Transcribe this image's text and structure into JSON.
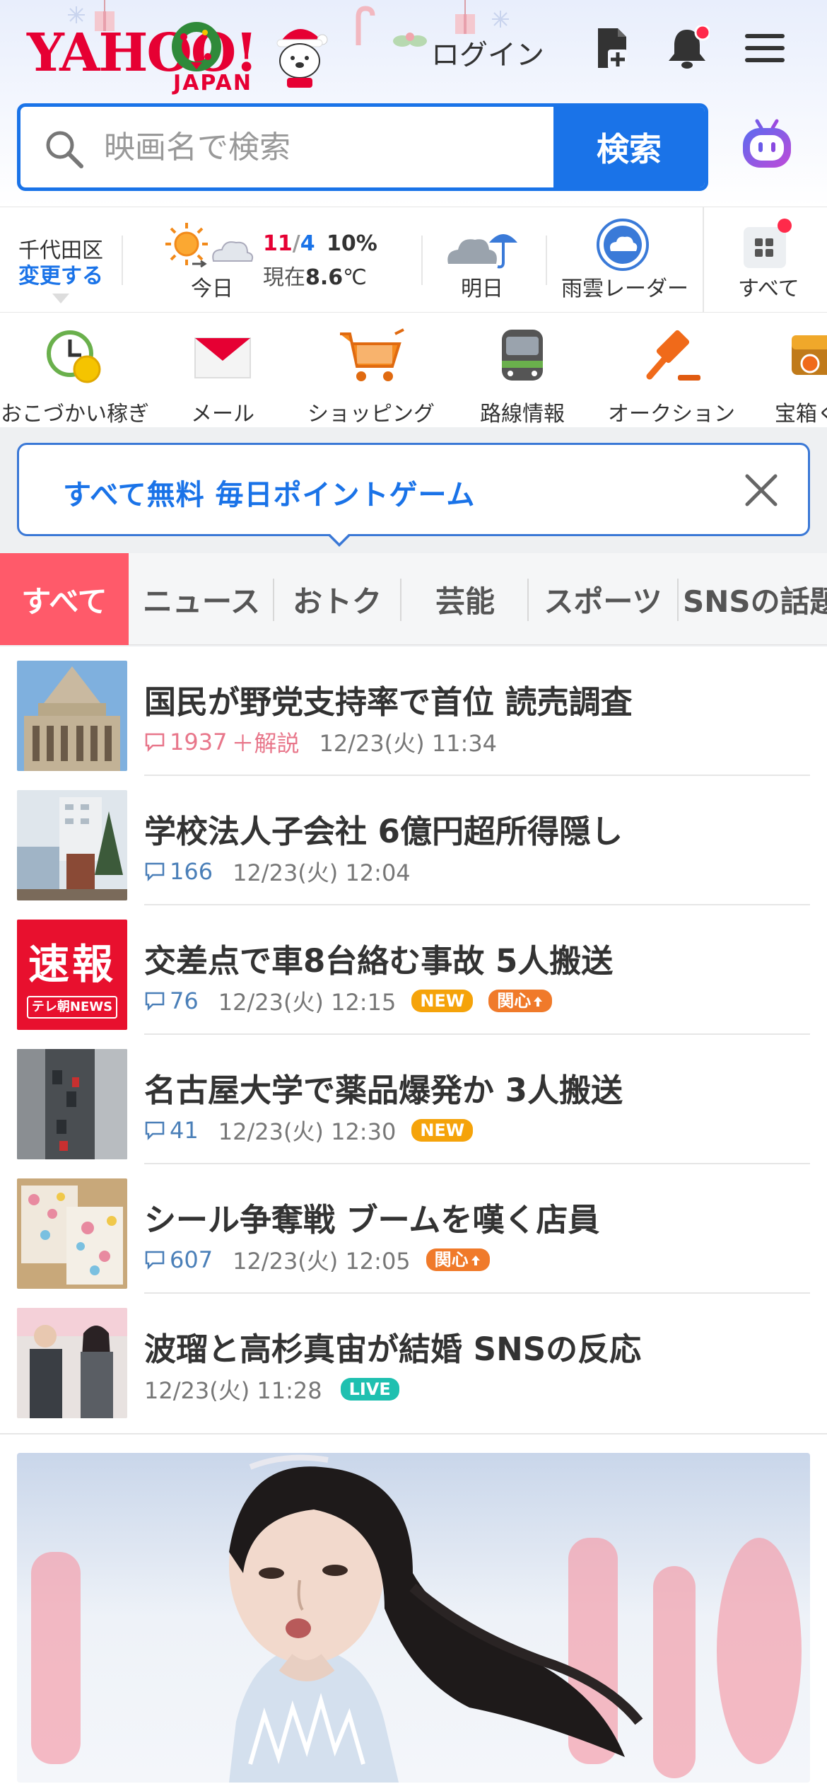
{
  "header": {
    "logo_main": "YAHOO!",
    "logo_sub": "JAPAN",
    "login_label": "ログイン"
  },
  "search": {
    "placeholder": "映画名で検索",
    "button_label": "検索"
  },
  "weather": {
    "location": "千代田区",
    "change_label": "変更する",
    "today_label": "今日",
    "temp_high": "11",
    "temp_sep": "/",
    "temp_low": "4",
    "precip": "10%",
    "current_label": "現在",
    "current_temp": "8.6",
    "unit": "℃",
    "tomorrow_label": "明日",
    "radar_label": "雨雲レーダー",
    "all_label": "すべて"
  },
  "services": [
    {
      "label": "おこづかい稼ぎ"
    },
    {
      "label": "メール"
    },
    {
      "label": "ショッピング"
    },
    {
      "label": "路線情報"
    },
    {
      "label": "オークション"
    },
    {
      "label": "宝箱く"
    }
  ],
  "promo": {
    "text": "すべて無料 毎日ポイントゲーム"
  },
  "tabs": [
    {
      "label": "すべて"
    },
    {
      "label": "ニュース"
    },
    {
      "label": "おトク"
    },
    {
      "label": "芸能"
    },
    {
      "label": "スポーツ"
    },
    {
      "label": "SNSの話題"
    }
  ],
  "news": [
    {
      "title": "国民が野党支持率で首位 読売調査",
      "comments": "1937",
      "extra": "＋解説",
      "time": "12/23(火) 11:34",
      "badges": []
    },
    {
      "title": "学校法人子会社 6億円超所得隠し",
      "comments": "166",
      "extra": "",
      "time": "12/23(火) 12:04",
      "badges": []
    },
    {
      "title": "交差点で車8台絡む事故 5人搬送",
      "comments": "76",
      "extra": "",
      "time": "12/23(火) 12:15",
      "badges": [
        "NEW",
        "関心"
      ]
    },
    {
      "title": "名古屋大学で薬品爆発か 3人搬送",
      "comments": "41",
      "extra": "",
      "time": "12/23(火) 12:30",
      "badges": [
        "NEW"
      ]
    },
    {
      "title": "シール争奪戦 ブームを嘆く店員",
      "comments": "607",
      "extra": "",
      "time": "12/23(火) 12:05",
      "badges": [
        "関心"
      ]
    },
    {
      "title": "波瑠と高杉真宙が結婚 SNSの反応",
      "comments": "",
      "extra": "",
      "time": "12/23(火) 11:28",
      "badges": [
        "LIVE"
      ]
    }
  ],
  "thumb3": {
    "line1": "速報",
    "line2": "テレ朝NEWS"
  },
  "colors": {
    "brand_red": "#e60033",
    "link_blue": "#1a73e8",
    "tab_active": "#ff5a6a",
    "new_badge": "#f5a30a",
    "interest_badge": "#f07a2a",
    "live_badge": "#1fc0b0"
  }
}
